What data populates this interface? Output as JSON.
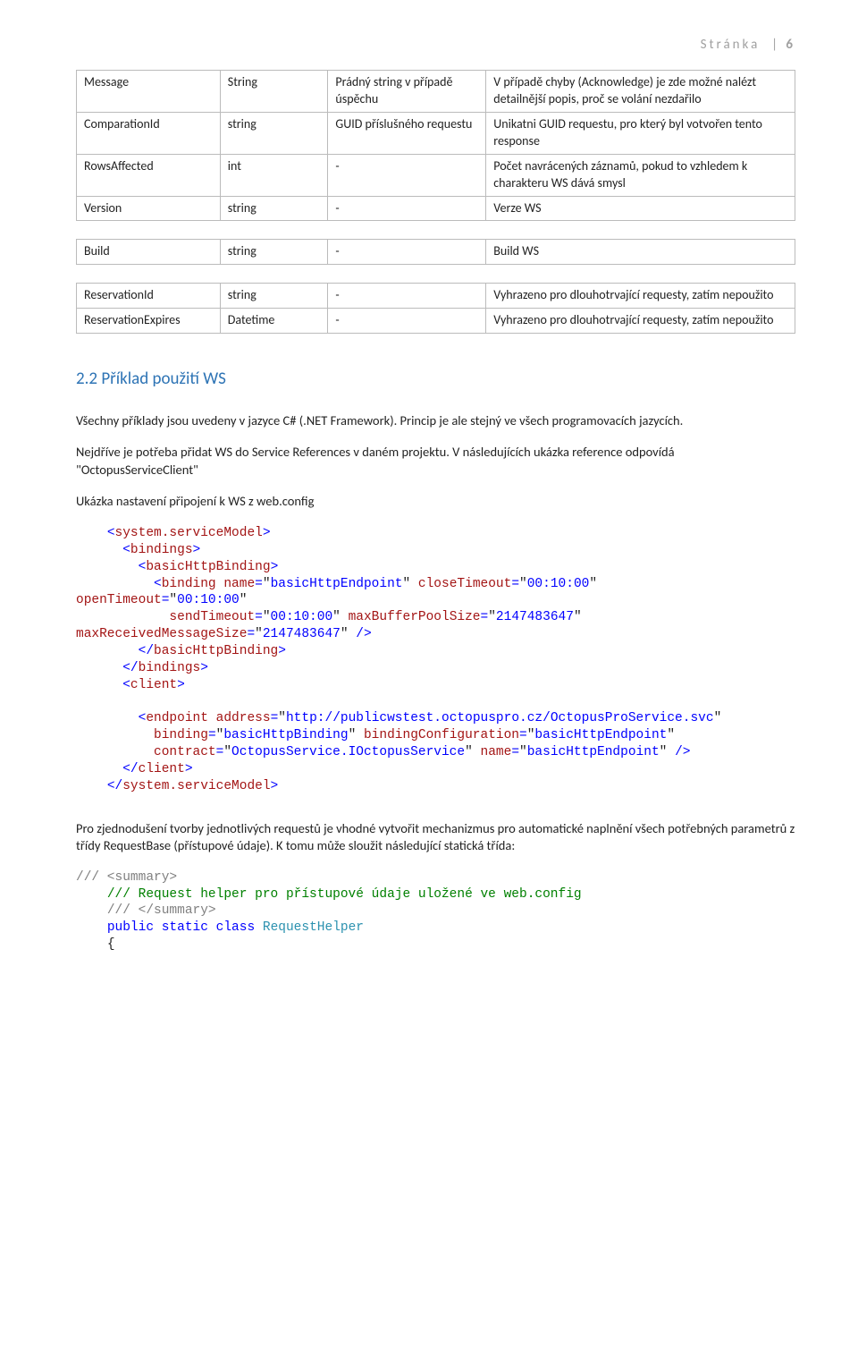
{
  "header": {
    "label": "Stránka",
    "number": "6"
  },
  "tables": [
    [
      {
        "c1": "Message",
        "c2": "String",
        "c3": "Prádný string v případě úspěchu",
        "c4": "V případě chyby (Acknowledge) je zde možné nalézt detailnější popis, proč se volání nezdařilo"
      },
      {
        "c1": "ComparationId",
        "c2": "string",
        "c3": "GUID příslušného requestu",
        "c4": "Unikatni GUID requestu, pro který byl votvořen tento response"
      },
      {
        "c1": "RowsAffected",
        "c2": "int",
        "c3": "-",
        "c4": "Počet navrácených záznamů, pokud to vzhledem k charakteru WS dává smysl"
      },
      {
        "c1": "Version",
        "c2": "string",
        "c3": "-",
        "c4": "Verze WS"
      }
    ],
    [
      {
        "c1": "Build",
        "c2": "string",
        "c3": "-",
        "c4": "Build WS"
      }
    ],
    [
      {
        "c1": "ReservationId",
        "c2": "string",
        "c3": "-",
        "c4": "Vyhrazeno pro dlouhotrvající requesty, zatím nepoužito"
      },
      {
        "c1": "ReservationExpires",
        "c2": "Datetime",
        "c3": "-",
        "c4": "Vyhrazeno pro dlouhotrvající requesty, zatím nepoužito"
      }
    ]
  ],
  "heading": "2.2   Příklad použití WS",
  "para1": "Všechny příklady jsou uvedeny v jazyce C# (.NET Framework). Princip je ale stejný ve všech programovacích jazycích.",
  "para2": "Nejdříve je potřeba přidat WS do Service References v daném projektu. V následujících ukázka reference odpovídá \"OctopusServiceClient\"",
  "para3": "Ukázka nastavení připojení k WS z web.config",
  "code1": {
    "t": {
      "systemOpen": "system.serviceModel",
      "bindings": "bindings",
      "basicHttpBinding": "basicHttpBinding",
      "binding": "binding",
      "name": "name",
      "closeTimeout": "closeTimeout",
      "openTimeout": "openTimeout",
      "sendTimeout": "sendTimeout",
      "maxBufferPoolSize": "maxBufferPoolSize",
      "maxReceivedMessageSize": "maxReceivedMessageSize",
      "client": "client",
      "endpoint": "endpoint",
      "address": "address",
      "bindingAttr": "binding",
      "bindingConfiguration": "bindingConfiguration",
      "contract": "contract"
    },
    "v": {
      "bhep": "basicHttpEndpoint",
      "t10": "00:10:00",
      "big": "2147483647",
      "url": "http://publicwstest.octopuspro.cz/OctopusProService.svc",
      "bhb": "basicHttpBinding",
      "ios": "OctopusService.IOctopusService"
    }
  },
  "para4": "Pro zjednodušení tvorby jednotlivých requestů je vhodné vytvořit mechanizmus pro automatické naplnění všech potřebných parametrů z třídy RequestBase (přístupové údaje). K tomu může sloužit následující statická třída:",
  "code2": {
    "sumOpen": "/// <summary>",
    "sumText": "/// Request helper pro přístupové údaje uložené ve web.config",
    "sumClose": "/// </summary>",
    "kwPublic": "public",
    "kwStatic": "static",
    "kwClass": "class",
    "className": "RequestHelper",
    "brace": "{"
  }
}
